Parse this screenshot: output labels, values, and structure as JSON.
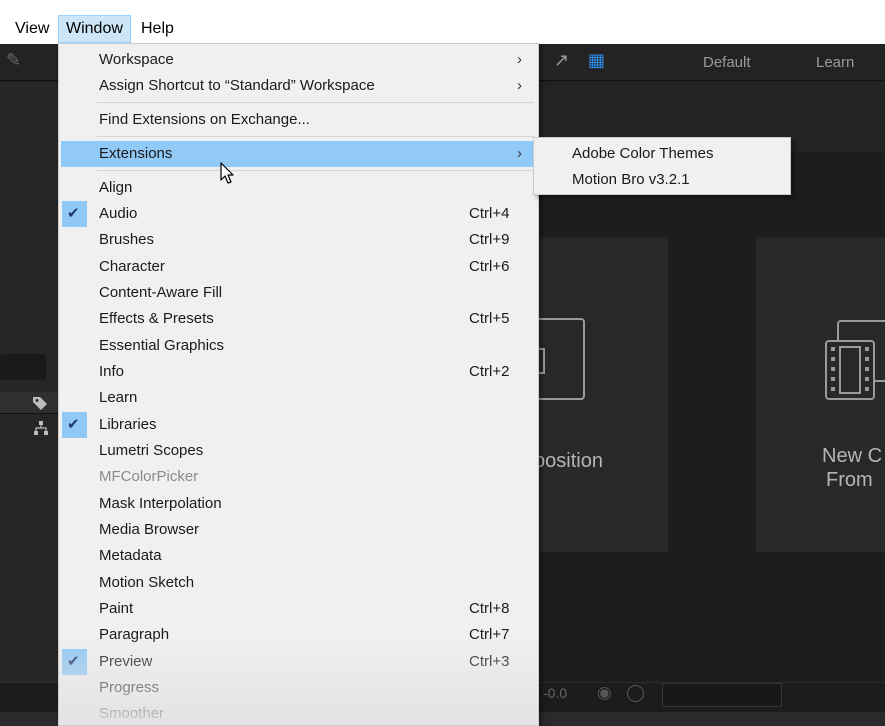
{
  "menubar": {
    "items": [
      {
        "label": "View"
      },
      {
        "label": "Window"
      },
      {
        "label": "Help"
      }
    ]
  },
  "workspace_tabs": {
    "default": "Default",
    "learn": "Learn"
  },
  "home_cards": {
    "composition_partial": "position",
    "new_comp_line1": "New C",
    "new_comp_line2": "From"
  },
  "status_bar": {
    "value": "-0.0"
  },
  "window_menu": {
    "items": [
      {
        "label": "Workspace",
        "shortcut": "",
        "submenu": true
      },
      {
        "label": "Assign Shortcut to “Standard” Workspace",
        "shortcut": "",
        "submenu": true
      },
      {
        "label": "Find Extensions on Exchange...",
        "shortcut": ""
      },
      {
        "label": "Extensions",
        "shortcut": "",
        "submenu": true,
        "highlighted": true
      },
      {
        "label": "Align",
        "shortcut": ""
      },
      {
        "label": "Audio",
        "shortcut": "Ctrl+4",
        "checked": true
      },
      {
        "label": "Brushes",
        "shortcut": "Ctrl+9"
      },
      {
        "label": "Character",
        "shortcut": "Ctrl+6"
      },
      {
        "label": "Content-Aware Fill",
        "shortcut": ""
      },
      {
        "label": "Effects & Presets",
        "shortcut": "Ctrl+5"
      },
      {
        "label": "Essential Graphics",
        "shortcut": ""
      },
      {
        "label": "Info",
        "shortcut": "Ctrl+2"
      },
      {
        "label": "Learn",
        "shortcut": ""
      },
      {
        "label": "Libraries",
        "shortcut": "",
        "checked": true
      },
      {
        "label": "Lumetri Scopes",
        "shortcut": ""
      },
      {
        "label": "MFColorPicker",
        "shortcut": "",
        "disabled": true
      },
      {
        "label": "Mask Interpolation",
        "shortcut": ""
      },
      {
        "label": "Media Browser",
        "shortcut": ""
      },
      {
        "label": "Metadata",
        "shortcut": ""
      },
      {
        "label": "Motion Sketch",
        "shortcut": ""
      },
      {
        "label": "Paint",
        "shortcut": "Ctrl+8"
      },
      {
        "label": "Paragraph",
        "shortcut": "Ctrl+7"
      },
      {
        "label": "Preview",
        "shortcut": "Ctrl+3",
        "checked": true
      },
      {
        "label": "Progress",
        "shortcut": ""
      },
      {
        "label": "Smoother",
        "shortcut": ""
      }
    ]
  },
  "extensions_submenu": {
    "items": [
      {
        "label": "Adobe Color Themes"
      },
      {
        "label": "Motion Bro v3.2.1"
      }
    ]
  },
  "icons": {
    "check": "checkmark-icon",
    "arrow": "chevron-right-icon",
    "cursor": "mouse-pointer-icon"
  },
  "colors": {
    "highlight": "#91c9f7",
    "menu_bg": "#f0f0f0",
    "app_bg": "#1e1e1e"
  }
}
